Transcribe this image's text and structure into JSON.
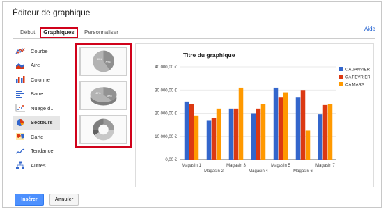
{
  "dialog": {
    "title": "Éditeur de graphique",
    "help_label": "Aide"
  },
  "tabs": [
    {
      "label": "Début",
      "active": false
    },
    {
      "label": "Graphiques",
      "active": true
    },
    {
      "label": "Personnaliser",
      "active": false
    }
  ],
  "sidebar": {
    "items": [
      {
        "label": "Courbe",
        "icon": "line-chart-icon",
        "active": false
      },
      {
        "label": "Aire",
        "icon": "area-chart-icon",
        "active": false
      },
      {
        "label": "Colonne",
        "icon": "column-chart-icon",
        "active": false
      },
      {
        "label": "Barre",
        "icon": "bar-chart-icon",
        "active": false
      },
      {
        "label": "Nuage d...",
        "icon": "scatter-chart-icon",
        "active": false
      },
      {
        "label": "Secteurs",
        "icon": "pie-chart-icon",
        "active": true
      },
      {
        "label": "Carte",
        "icon": "map-chart-icon",
        "active": false
      },
      {
        "label": "Tendance",
        "icon": "trend-chart-icon",
        "active": false
      },
      {
        "label": "Autres",
        "icon": "other-chart-icon",
        "active": false
      }
    ]
  },
  "thumbnails": [
    {
      "name": "pie-thumbnail",
      "labels": [
        "40%",
        "60%"
      ]
    },
    {
      "name": "3d-pie-thumbnail",
      "labels": [
        "40%",
        "60%"
      ]
    },
    {
      "name": "donut-thumbnail",
      "labels": []
    }
  ],
  "chart_data": {
    "type": "bar",
    "title": "Titre du graphique",
    "xlabel": "",
    "ylabel": "",
    "ylim": [
      0,
      40000
    ],
    "y_ticks": [
      "0,00 €",
      "10 000,00 €",
      "20 000,00 €",
      "30 000,00 €",
      "40 000,00 €"
    ],
    "y_tick_values": [
      0,
      10000,
      20000,
      30000,
      40000
    ],
    "categories": [
      "Magasin 1",
      "Magasin 2",
      "Magasin 3",
      "Magasin 4",
      "Magasin 5",
      "Magasin 6",
      "Magasin 7"
    ],
    "series": [
      {
        "name": "CA JANVIER",
        "color": "#3366cc",
        "values": [
          25000,
          17000,
          22000,
          20000,
          31000,
          27000,
          19500
        ]
      },
      {
        "name": "CA FEVRIER",
        "color": "#dc3912",
        "values": [
          24000,
          18000,
          22000,
          22000,
          27000,
          30000,
          23500
        ]
      },
      {
        "name": "CA MARS",
        "color": "#ff9900",
        "values": [
          19000,
          22000,
          31000,
          24000,
          29000,
          12500,
          24000
        ]
      }
    ],
    "legend_position": "right",
    "grid": true
  },
  "footer": {
    "insert_label": "Insérer",
    "cancel_label": "Annuler"
  }
}
